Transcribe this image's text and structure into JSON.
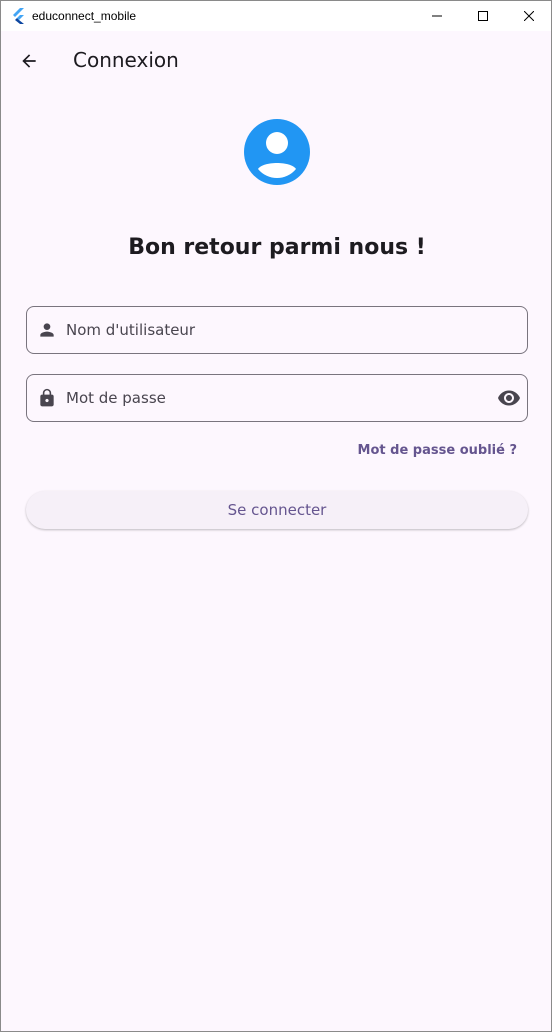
{
  "window": {
    "title": "educonnect_mobile"
  },
  "appbar": {
    "title": "Connexion"
  },
  "login": {
    "heading": "Bon retour parmi nous !",
    "username_placeholder": "Nom d'utilisateur",
    "password_placeholder": "Mot de passe",
    "forgot_label": "Mot de passe oublié ?",
    "submit_label": "Se connecter"
  },
  "icons": {
    "back": "arrow-back-icon",
    "avatar": "account-circle-icon",
    "user": "person-icon",
    "lock": "lock-icon",
    "visibility": "eye-icon"
  },
  "colors": {
    "accent": "#65558f",
    "avatar": "#2196f3",
    "background": "#fdf7fe",
    "button_bg": "#f6f0f8",
    "outline": "#79747e"
  }
}
